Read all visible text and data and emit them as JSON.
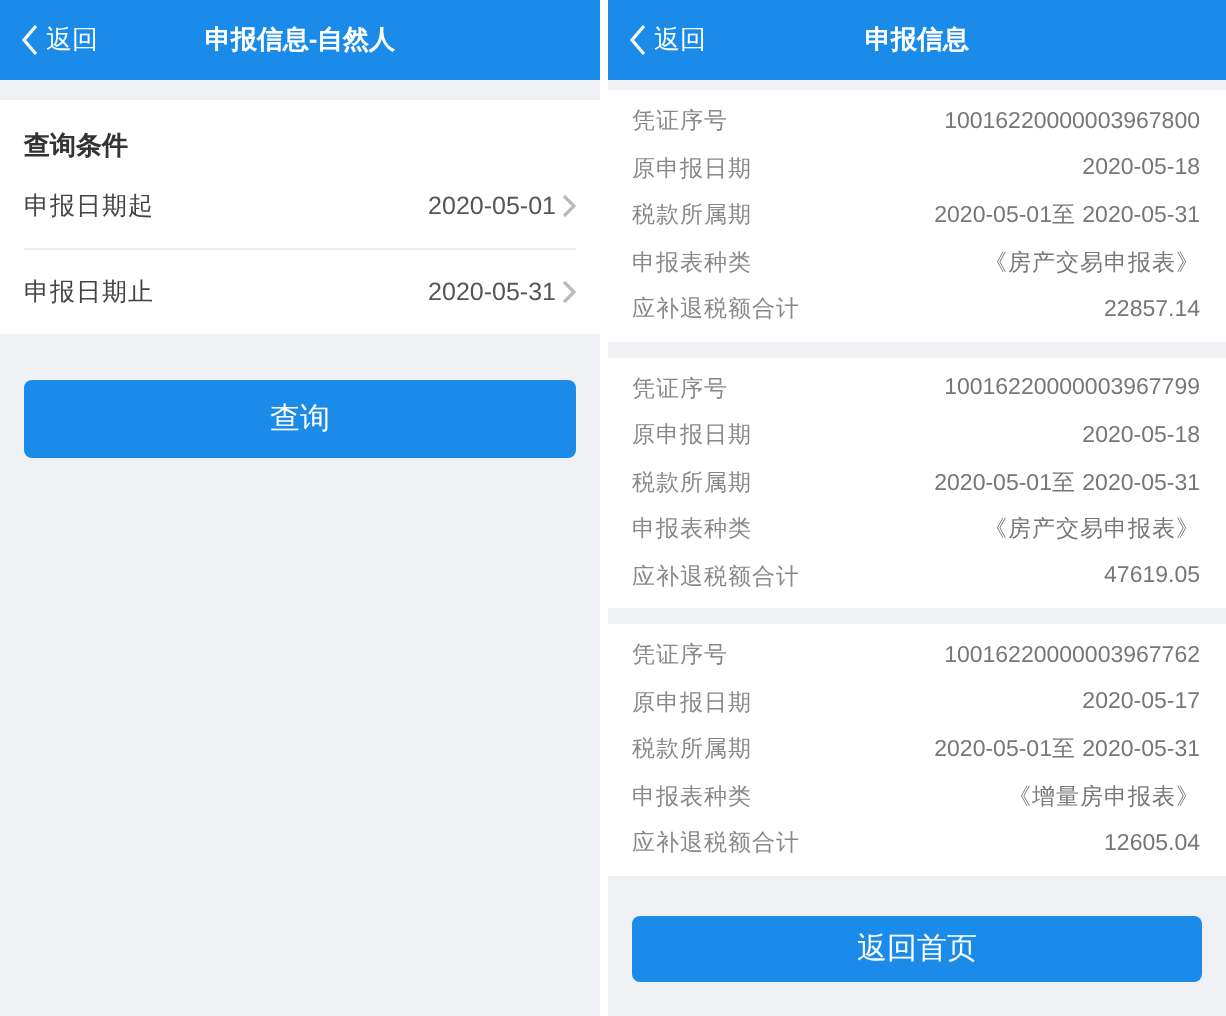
{
  "query_screen": {
    "header": {
      "back": "返回",
      "title": "申报信息-自然人"
    },
    "section_title": "查询条件",
    "fields": [
      {
        "label": "申报日期起",
        "value": "2020-05-01"
      },
      {
        "label": "申报日期止",
        "value": "2020-05-31"
      }
    ],
    "button": "查询"
  },
  "result_screen": {
    "header": {
      "back": "返回",
      "title": "申报信息"
    },
    "records": [
      {
        "fields": [
          {
            "label": "凭证序号",
            "value": "10016220000003967800"
          },
          {
            "label": "原申报日期",
            "value": "2020-05-18"
          },
          {
            "label": "税款所属期",
            "value": "2020-05-01至 2020-05-31"
          },
          {
            "label": "申报表种类",
            "value": "《房产交易申报表》"
          },
          {
            "label": "应补退税额合计",
            "value": "22857.14"
          }
        ]
      },
      {
        "fields": [
          {
            "label": "凭证序号",
            "value": "10016220000003967799"
          },
          {
            "label": "原申报日期",
            "value": "2020-05-18"
          },
          {
            "label": "税款所属期",
            "value": "2020-05-01至 2020-05-31"
          },
          {
            "label": "申报表种类",
            "value": "《房产交易申报表》"
          },
          {
            "label": "应补退税额合计",
            "value": "47619.05"
          }
        ]
      },
      {
        "fields": [
          {
            "label": "凭证序号",
            "value": "10016220000003967762"
          },
          {
            "label": "原申报日期",
            "value": "2020-05-17"
          },
          {
            "label": "税款所属期",
            "value": "2020-05-01至 2020-05-31"
          },
          {
            "label": "申报表种类",
            "value": "《增量房申报表》"
          },
          {
            "label": "应补退税额合计",
            "value": "12605.04"
          }
        ]
      }
    ],
    "button": "返回首页"
  }
}
